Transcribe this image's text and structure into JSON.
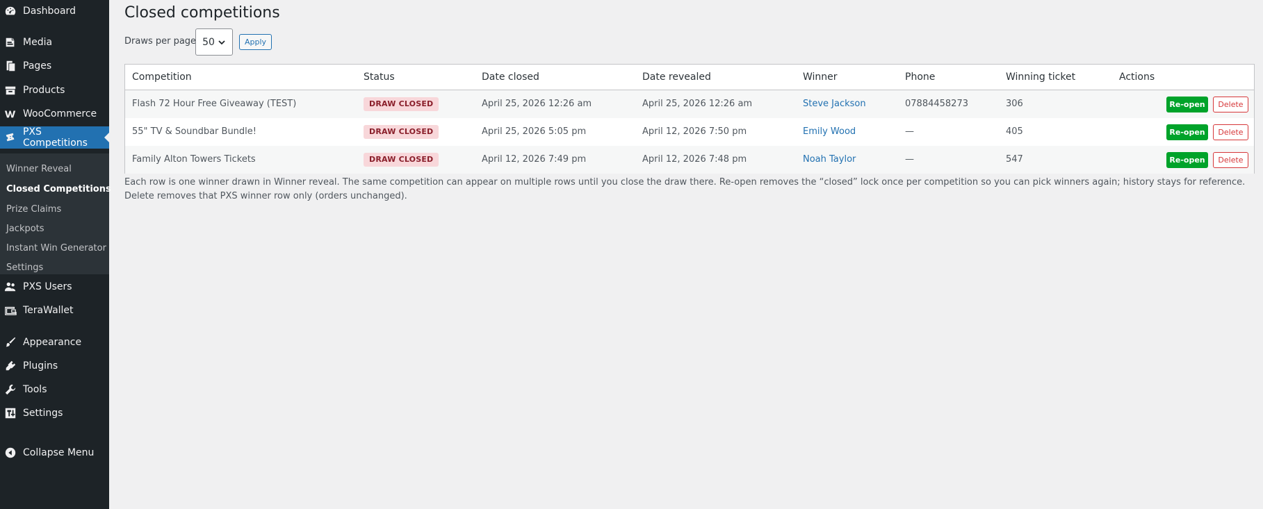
{
  "sidebar": {
    "items": [
      {
        "label": "Dashboard",
        "icon": "dashboard-icon"
      },
      {
        "label": "Media",
        "icon": "media-icon"
      },
      {
        "label": "Pages",
        "icon": "pages-icon"
      },
      {
        "label": "Products",
        "icon": "products-icon"
      },
      {
        "label": "WooCommerce",
        "icon": "woocommerce-icon"
      },
      {
        "label": "PXS Competitions",
        "icon": "tickets-icon"
      },
      {
        "label": "PXS Users",
        "icon": "users-icon"
      },
      {
        "label": "TeraWallet",
        "icon": "wallet-icon"
      },
      {
        "label": "Appearance",
        "icon": "appearance-brush-icon"
      },
      {
        "label": "Plugins",
        "icon": "plugins-icon"
      },
      {
        "label": "Tools",
        "icon": "tools-wrench-icon"
      },
      {
        "label": "Settings",
        "icon": "settings-icon"
      },
      {
        "label": "Collapse Menu",
        "icon": "collapse-icon"
      }
    ],
    "submenu": [
      "Winner Reveal",
      "Closed Competitions",
      "Prize Claims",
      "Jackpots",
      "Instant Win Generator",
      "Settings"
    ],
    "active_item": "PXS Competitions",
    "current_subitem": "Closed Competitions"
  },
  "page": {
    "title": "Closed competitions",
    "per_page_label": "Draws per page:",
    "per_page_value": "50",
    "apply_label": "Apply"
  },
  "table": {
    "columns": [
      "Competition",
      "Status",
      "Date closed",
      "Date revealed",
      "Winner",
      "Phone",
      "Winning ticket",
      "Actions"
    ],
    "rows": [
      {
        "competition": "Flash 72 Hour Free Giveaway (TEST)",
        "status": "DRAW CLOSED",
        "date_closed": "April 25, 2026 12:26 am",
        "date_revealed": "April 25, 2026 12:26 am",
        "winner": "Steve Jackson",
        "phone": "07884458273",
        "ticket": "306",
        "reopen": "Re-open",
        "delete": "Delete"
      },
      {
        "competition": "55\" TV & Soundbar Bundle!",
        "status": "DRAW CLOSED",
        "date_closed": "April 25, 2026 5:05 pm",
        "date_revealed": "April 12, 2026 7:50 pm",
        "winner": "Emily Wood",
        "phone": "—",
        "ticket": "405",
        "reopen": "Re-open",
        "delete": "Delete"
      },
      {
        "competition": "Family Alton Towers Tickets",
        "status": "DRAW CLOSED",
        "date_closed": "April 12, 2026 7:49 pm",
        "date_revealed": "April 12, 2026 7:48 pm",
        "winner": "Noah Taylor",
        "phone": "—",
        "ticket": "547",
        "reopen": "Re-open",
        "delete": "Delete"
      }
    ]
  },
  "note": "Each row is one winner drawn in Winner reveal. The same competition can appear on multiple rows until you close the draw there. Re-open removes the “closed” lock once per competition so you can pick winners again; history stays for reference. Delete removes that PXS winner row only (orders unchanged).",
  "colors": {
    "sidebar_bg": "#1d2327",
    "submenu_bg": "#2c3338",
    "accent": "#2271b1",
    "reopen_green": "#00a32a",
    "delete_red": "#d63638",
    "badge_bg": "#f8d7da"
  }
}
